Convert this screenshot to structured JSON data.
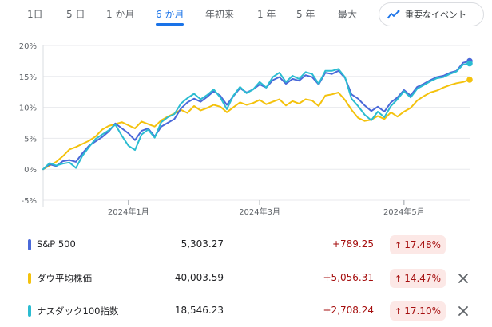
{
  "tabs": [
    {
      "label": "1日",
      "active": false
    },
    {
      "label": "5 日",
      "active": false
    },
    {
      "label": "1 か月",
      "active": false
    },
    {
      "label": "6 か月",
      "active": true
    },
    {
      "label": "年初来",
      "active": false
    },
    {
      "label": "1 年",
      "active": false
    },
    {
      "label": "5 年",
      "active": false
    },
    {
      "label": "最大",
      "active": false
    }
  ],
  "events_button": {
    "label": "重要なイベント",
    "icon": "trend-icon",
    "color": "#1a73e8"
  },
  "chart_data": {
    "type": "line",
    "title": "",
    "xlabel": "",
    "ylabel": "",
    "ylim": [
      -5,
      20
    ],
    "yticks": [
      -5,
      0,
      5,
      10,
      15,
      20
    ],
    "ytick_labels": [
      "-5%",
      "0%",
      "5%",
      "10%",
      "15%",
      "20%"
    ],
    "x_range": [
      0,
      130
    ],
    "xticks": [
      {
        "x": 26,
        "label": "2024年1月"
      },
      {
        "x": 66,
        "label": "2024年3月"
      },
      {
        "x": 110,
        "label": "2024年5月"
      }
    ],
    "grid": true,
    "series": [
      {
        "name": "S&P 500",
        "color": "#4a69d9",
        "x": [
          0,
          2,
          4,
          6,
          8,
          10,
          12,
          14,
          16,
          18,
          20,
          22,
          24,
          26,
          28,
          30,
          32,
          34,
          36,
          38,
          40,
          42,
          44,
          46,
          48,
          50,
          52,
          54,
          56,
          58,
          60,
          62,
          64,
          66,
          68,
          70,
          72,
          74,
          76,
          78,
          80,
          82,
          84,
          86,
          88,
          90,
          92,
          94,
          96,
          98,
          100,
          102,
          104,
          106,
          108,
          110,
          112,
          114,
          116,
          118,
          120,
          122,
          124,
          126,
          128,
          130
        ],
        "values": [
          0,
          0.8,
          0.5,
          1.3,
          1.5,
          1.2,
          2.6,
          3.8,
          4.5,
          5.2,
          6.1,
          7.4,
          6.6,
          5.8,
          4.7,
          6.2,
          6.6,
          5.3,
          6.9,
          7.5,
          8.1,
          9.8,
          10.8,
          11.4,
          10.9,
          11.7,
          12.6,
          11.9,
          10.4,
          11.8,
          13.1,
          12.4,
          12.9,
          13.7,
          13.2,
          14.4,
          14.9,
          13.8,
          14.6,
          14.3,
          15.2,
          14.9,
          13.7,
          15.6,
          15.4,
          15.9,
          14.8,
          12.1,
          11.4,
          10.3,
          9.4,
          10.1,
          9.3,
          10.8,
          11.6,
          12.8,
          11.9,
          13.3,
          13.8,
          14.4,
          14.9,
          15.1,
          15.6,
          15.9,
          17.2,
          17.48
        ]
      },
      {
        "name": "ダウ平均株価",
        "color": "#f4c20d",
        "x": [
          0,
          2,
          4,
          6,
          8,
          10,
          12,
          14,
          16,
          18,
          20,
          22,
          24,
          26,
          28,
          30,
          32,
          34,
          36,
          38,
          40,
          42,
          44,
          46,
          48,
          50,
          52,
          54,
          56,
          58,
          60,
          62,
          64,
          66,
          68,
          70,
          72,
          74,
          76,
          78,
          80,
          82,
          84,
          86,
          88,
          90,
          92,
          94,
          96,
          98,
          100,
          102,
          104,
          106,
          108,
          110,
          112,
          114,
          116,
          118,
          120,
          122,
          124,
          126,
          128,
          130
        ],
        "values": [
          0,
          0.6,
          1.2,
          2.1,
          3.2,
          3.6,
          4.1,
          4.6,
          5.3,
          6.4,
          7.0,
          7.3,
          7.6,
          7.1,
          6.6,
          7.7,
          7.3,
          6.9,
          7.9,
          8.5,
          9.0,
          9.6,
          9.1,
          10.2,
          9.5,
          9.9,
          10.4,
          10.1,
          9.2,
          10.0,
          10.8,
          10.4,
          10.7,
          11.2,
          10.5,
          10.9,
          11.3,
          10.3,
          11.0,
          10.6,
          11.3,
          11.1,
          10.2,
          11.9,
          12.1,
          12.4,
          11.2,
          9.6,
          8.3,
          7.8,
          8.0,
          8.6,
          8.1,
          9.2,
          8.5,
          9.3,
          9.9,
          11.1,
          11.8,
          12.4,
          12.7,
          13.2,
          13.6,
          13.9,
          14.1,
          14.47
        ]
      },
      {
        "name": "ナスダック100指数",
        "color": "#2bbcd1",
        "x": [
          0,
          2,
          4,
          6,
          8,
          10,
          12,
          14,
          16,
          18,
          20,
          22,
          24,
          26,
          28,
          30,
          32,
          34,
          36,
          38,
          40,
          42,
          44,
          46,
          48,
          50,
          52,
          54,
          56,
          58,
          60,
          62,
          64,
          66,
          68,
          70,
          72,
          74,
          76,
          78,
          80,
          82,
          84,
          86,
          88,
          90,
          92,
          94,
          96,
          98,
          100,
          102,
          104,
          106,
          108,
          110,
          112,
          114,
          116,
          118,
          120,
          122,
          124,
          126,
          128,
          130
        ],
        "values": [
          0,
          1.0,
          0.6,
          0.9,
          1.1,
          0.2,
          2.2,
          3.6,
          4.9,
          5.6,
          6.3,
          7.2,
          5.4,
          3.8,
          3.1,
          5.6,
          6.4,
          5.1,
          7.6,
          8.4,
          8.9,
          10.6,
          11.5,
          12.2,
          11.3,
          12.0,
          12.9,
          11.6,
          9.7,
          11.9,
          13.3,
          12.3,
          12.9,
          14.1,
          13.2,
          14.9,
          15.6,
          14.1,
          15.1,
          14.6,
          15.7,
          15.4,
          13.8,
          15.9,
          15.9,
          16.2,
          14.9,
          11.4,
          10.2,
          8.8,
          7.9,
          9.3,
          8.4,
          10.2,
          11.3,
          12.6,
          11.6,
          13.0,
          13.6,
          14.2,
          14.7,
          14.9,
          15.4,
          15.8,
          16.9,
          17.1
        ]
      }
    ]
  },
  "legend": [
    {
      "name": "S&P 500",
      "color": "#4a69d9",
      "value": "5,303.27",
      "change": "+789.25",
      "percent": "17.48%",
      "closable": false
    },
    {
      "name": "ダウ平均株価",
      "color": "#f4c20d",
      "value": "40,003.59",
      "change": "+5,056.31",
      "percent": "14.47%",
      "closable": true
    },
    {
      "name": "ナスダック100指数",
      "color": "#2bbcd1",
      "value": "18,546.23",
      "change": "+2,708.24",
      "percent": "17.10%",
      "closable": true
    }
  ],
  "colors": {
    "accent": "#1a73e8",
    "positive": "#a50e0e",
    "positive_bg": "#fce8e6",
    "grid": "#e8eaed"
  }
}
